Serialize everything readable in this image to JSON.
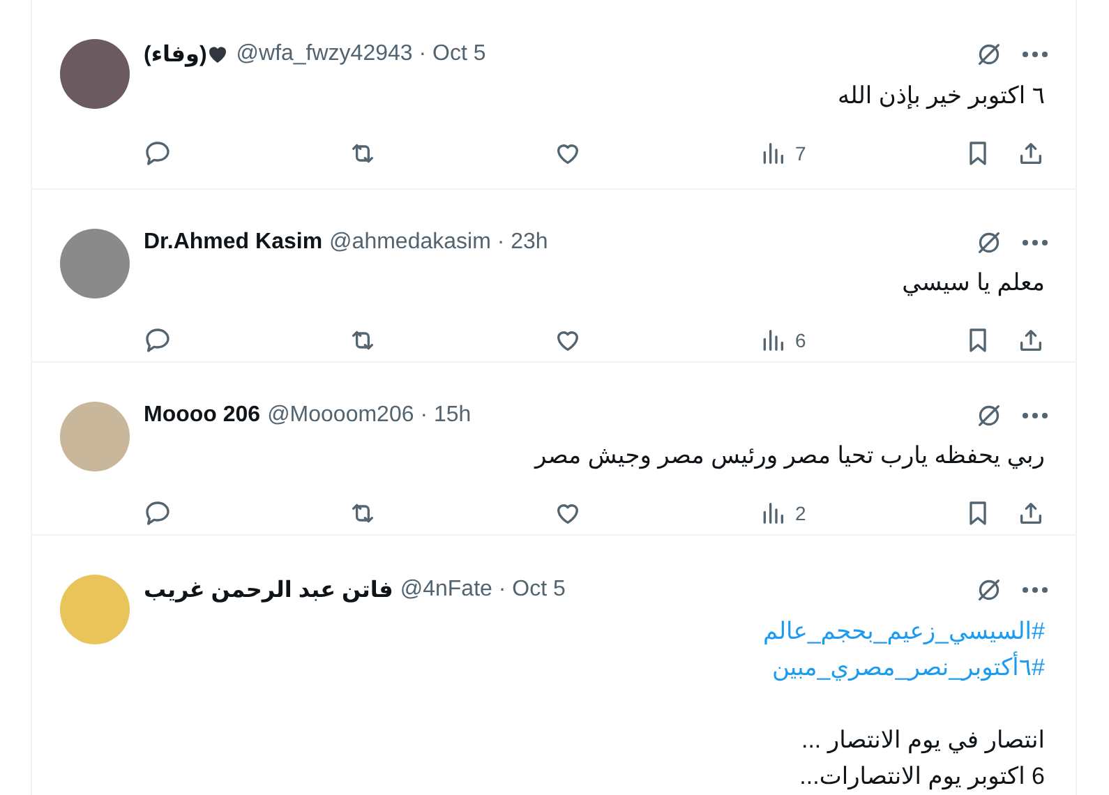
{
  "tweets": [
    {
      "name": "(وفاء)",
      "heart_emoji": true,
      "byline": "@wfa_fwzy42943 · Oct 5",
      "body": [
        {
          "kind": "text",
          "text": "٦ اكتوبر خير بإذن الله"
        }
      ],
      "views": "7"
    },
    {
      "name": "Dr.Ahmed Kasim",
      "byline": "@ahmedakasim · 23h",
      "body": [
        {
          "kind": "text",
          "text": "معلم يا سيسي"
        }
      ],
      "views": "6"
    },
    {
      "name": "Moooo 206",
      "byline": "@Moooom206 · 15h",
      "body": [
        {
          "kind": "text",
          "text": "ربي يحفظه يارب تحيا مصر ورئيس مصر وجيش مصر"
        }
      ],
      "views": "2"
    },
    {
      "name": "فاتن عبد الرحمن غريب",
      "byline": "@4nFate · Oct 5",
      "body": [
        {
          "kind": "hashtag",
          "text": "#السيسي_زعيم_بحجم_عالم"
        },
        {
          "kind": "hashtag",
          "text": "#٦أكتوبر_نصر_مصري_مبين"
        },
        {
          "kind": "text",
          "text": "انتصار في يوم الانتصار ..."
        },
        {
          "kind": "text",
          "text": "6 اكتوبر يوم الانتصارات..."
        }
      ]
    }
  ]
}
